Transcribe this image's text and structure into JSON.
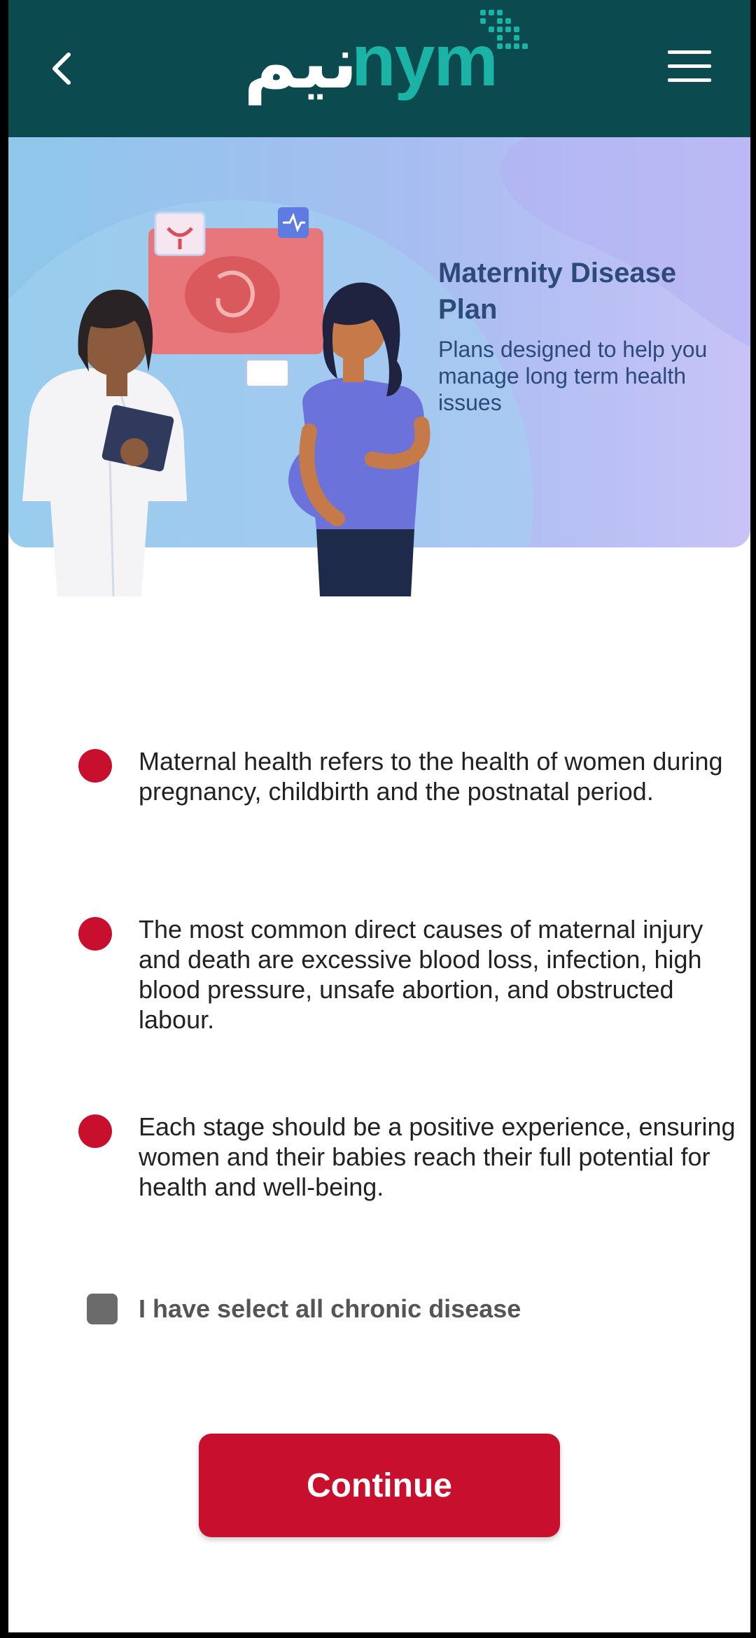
{
  "header": {
    "logo_arabic": "نيم",
    "logo_latin": "nym",
    "back_icon": "chevron-left-icon",
    "menu_icon": "hamburger-menu-icon"
  },
  "hero": {
    "title": "Maternity Disease Plan",
    "subtitle": "Plans designed to help you manage long term health issues"
  },
  "bullets": [
    {
      "text": "Maternal health refers to the health of women during pregnancy, childbirth and the postnatal period."
    },
    {
      "text": "The most common direct causes of maternal injury and death are excessive blood loss, infection, high blood pressure, unsafe abortion, and obstructed labour."
    },
    {
      "text": "Each stage should be a positive experience, ensuring women and their babies reach their full potential for health and well-being."
    }
  ],
  "checkbox": {
    "label": "I have select all chronic disease",
    "checked": false
  },
  "continue_button": {
    "label": "Continue"
  },
  "colors": {
    "header_bg": "#0b4a4f",
    "brand_teal": "#1ab3a6",
    "accent_red": "#c8102e"
  }
}
